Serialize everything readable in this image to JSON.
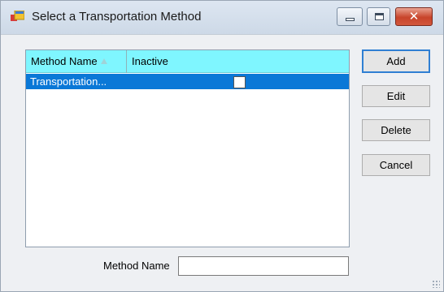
{
  "window": {
    "title": "Select a Transportation Method",
    "controls": {
      "minimize": "minimize",
      "maximize": "maximize",
      "close": "✕"
    }
  },
  "list": {
    "columns": [
      "Method Name",
      "Inactive"
    ],
    "sort": {
      "column": "Method Name",
      "direction": "ascending"
    },
    "rows": [
      {
        "name": "Transportation...",
        "inactive": false,
        "selected": true
      }
    ],
    "header_color": "#7ff6ff",
    "selection_color": "#0a78d7"
  },
  "buttons": {
    "add": "Add",
    "edit": "Edit",
    "delete": "Delete",
    "cancel": "Cancel"
  },
  "filter": {
    "label": "Method Name",
    "value": ""
  }
}
